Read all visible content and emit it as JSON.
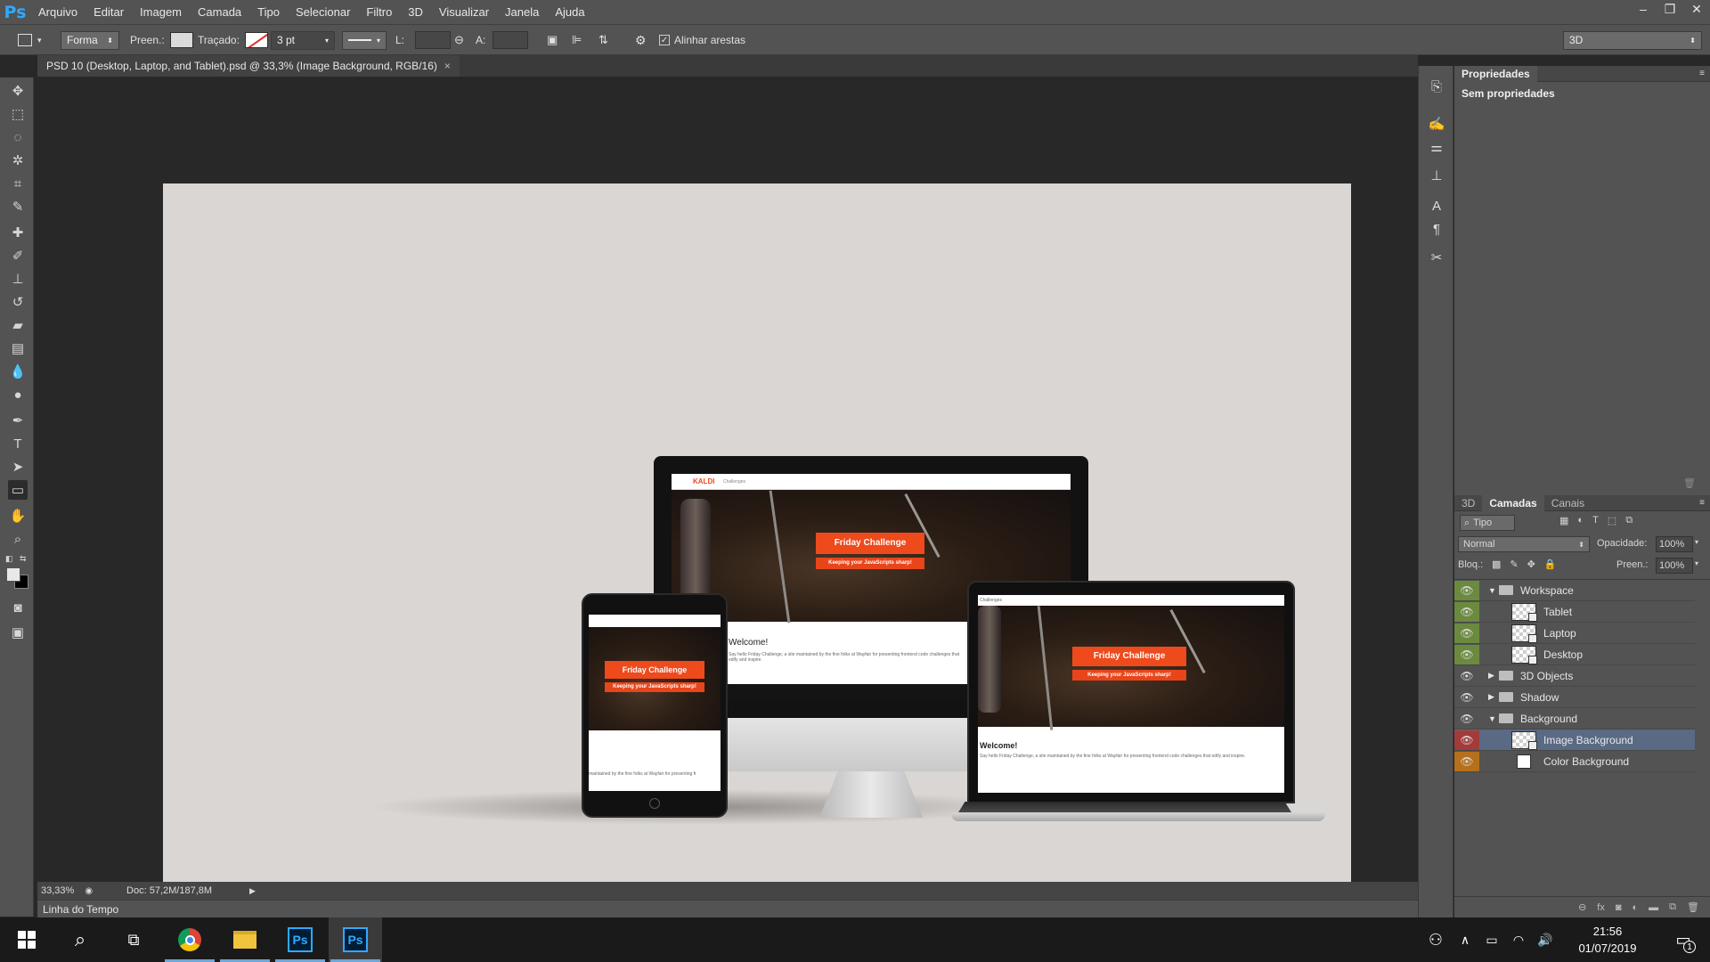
{
  "app": {
    "logo": "Ps",
    "menu": [
      "Arquivo",
      "Editar",
      "Imagem",
      "Camada",
      "Tipo",
      "Selecionar",
      "Filtro",
      "3D",
      "Visualizar",
      "Janela",
      "Ajuda"
    ]
  },
  "options": {
    "mode": "Forma",
    "fill_label": "Preen.:",
    "stroke_label": "Traçado:",
    "stroke_size": "3 pt",
    "w_label": "L:",
    "h_label": "A:",
    "align_edges": "Alinhar arestas",
    "workspace": "3D"
  },
  "document": {
    "tab_title": "PSD 10 (Desktop, Laptop, and Tablet).psd @ 33,3% (Image Background, RGB/16)",
    "close": "×"
  },
  "artwork": {
    "brand": "KALDI",
    "brand_sub": "Challenges",
    "headline": "Friday Challenge",
    "tagline": "Keeping your JavaScripts sharp!",
    "welcome": "Welcome!",
    "body_desktop": "Say hello Friday Challenge, a site maintained by the fine folks at Wayfair for presenting frontend code challenges that edify and inspire.",
    "body_laptop": "Say hello Friday Challenge, a site maintained by the fine folks at Wayfair for presenting frontend code challenges that edify and inspire.",
    "body_tablet": "maintained by the fine folks at Wayfair for presenting fr",
    "laptop_nav": "Challenges"
  },
  "status": {
    "zoom": "33,33%",
    "doc": "Doc: 57,2M/187,8M",
    "timeline": "Linha do Tempo"
  },
  "properties": {
    "tab": "Propriedades",
    "empty": "Sem propriedades"
  },
  "layers_panel": {
    "tabs": [
      "3D",
      "Camadas",
      "Canais"
    ],
    "filter": "Tipo",
    "blend_mode": "Normal",
    "opacity_label": "Opacidade:",
    "opacity": "100%",
    "lock_label": "Bloq.:",
    "fill_label": "Preen.:",
    "fill": "100%",
    "layers": [
      {
        "name": "Workspace",
        "kind": "group",
        "open": true,
        "indent": 0,
        "eye_color": "#6b8a3f"
      },
      {
        "name": "Tablet",
        "kind": "smart",
        "indent": 1,
        "eye_color": "#6b8a3f"
      },
      {
        "name": "Laptop",
        "kind": "smart",
        "indent": 1,
        "eye_color": "#6b8a3f"
      },
      {
        "name": "Desktop",
        "kind": "smart",
        "indent": 1,
        "eye_color": "#6b8a3f"
      },
      {
        "name": "3D Objects",
        "kind": "group",
        "open": false,
        "indent": 0,
        "eye_color": ""
      },
      {
        "name": "Shadow",
        "kind": "group",
        "open": false,
        "indent": 0,
        "eye_color": ""
      },
      {
        "name": "Background",
        "kind": "group",
        "open": true,
        "indent": 0,
        "eye_color": ""
      },
      {
        "name": "Image Background",
        "kind": "smart",
        "indent": 1,
        "eye_color": "#a33b3b",
        "selected": true
      },
      {
        "name": "Color Background",
        "kind": "fill",
        "indent": 1,
        "eye_color": "#b5701c"
      }
    ]
  },
  "taskbar": {
    "time": "21:56",
    "date": "01/07/2019",
    "notifications": "1"
  },
  "colors": {
    "ui_bg": "#535353",
    "canvas_bg": "#282828",
    "artboard": "#d9d6d3",
    "accent_orange": "#ee4a1c",
    "selection": "#5a6a84"
  }
}
